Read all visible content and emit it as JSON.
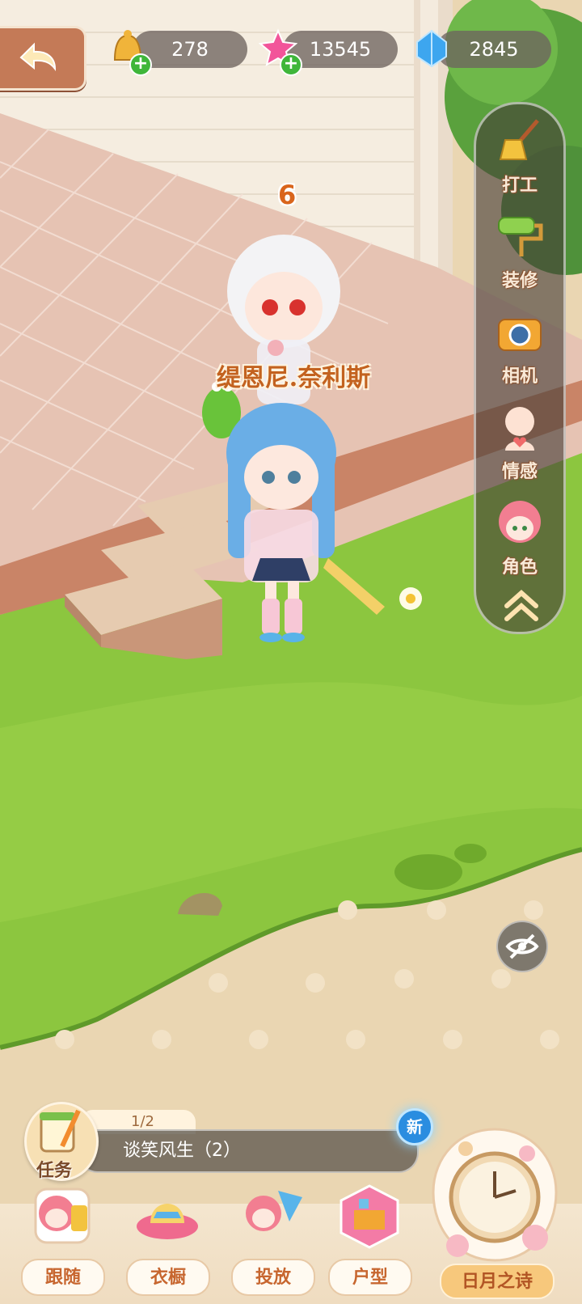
{
  "top_bar": {
    "currencies": [
      {
        "name": "bell-coin",
        "value": "278"
      },
      {
        "name": "pink-star",
        "value": "13545"
      },
      {
        "name": "blue-crystal",
        "value": "2845"
      }
    ]
  },
  "scene": {
    "level": "6",
    "npc_name": "缇恩尼.奈利斯"
  },
  "side_menu": {
    "items": [
      {
        "label": "打工",
        "icon": "broom-icon"
      },
      {
        "label": "装修",
        "icon": "paint-roller-icon"
      },
      {
        "label": "相机",
        "icon": "camera-icon"
      },
      {
        "label": "情感",
        "icon": "emotion-icon"
      },
      {
        "label": "角色",
        "icon": "character-icon"
      }
    ]
  },
  "task": {
    "label": "任务",
    "progress": "1/2",
    "title": "谈笑风生（2）",
    "badge": "新"
  },
  "bottom_nav": {
    "items": [
      {
        "label": "跟随"
      },
      {
        "label": "衣橱"
      },
      {
        "label": "投放"
      },
      {
        "label": "户型"
      }
    ],
    "special": {
      "label": "日月之诗"
    }
  },
  "colors": {
    "accent": "#c7662f",
    "grass": "#8cc63f",
    "floor": "#e8c4b4"
  }
}
